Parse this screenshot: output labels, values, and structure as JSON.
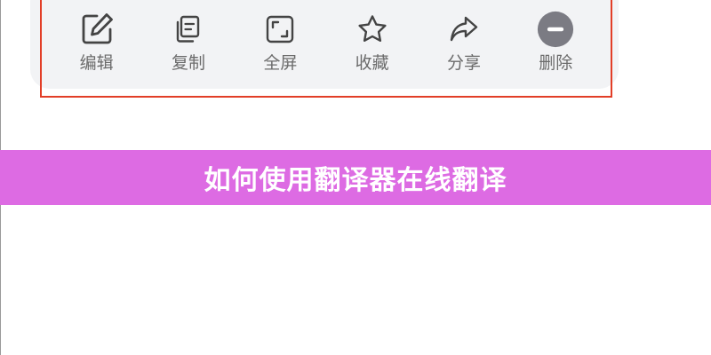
{
  "colors": {
    "panel_bg": "#f2f3f5",
    "highlight_border": "#e23e27",
    "icon_stroke": "#444444",
    "label_text": "#6b6b6b",
    "delete_icon_bg": "#7b7b83",
    "banner_bg": "#dd6be3",
    "banner_text": "#ffffff"
  },
  "toolbar": {
    "items": [
      {
        "label": "编辑",
        "icon": "edit-icon"
      },
      {
        "label": "复制",
        "icon": "copy-icon"
      },
      {
        "label": "全屏",
        "icon": "fullscreen-icon"
      },
      {
        "label": "收藏",
        "icon": "star-icon"
      },
      {
        "label": "分享",
        "icon": "share-icon"
      },
      {
        "label": "删除",
        "icon": "minus-circle-icon"
      }
    ]
  },
  "banner": {
    "title": "如何使用翻译器在线翻译"
  }
}
